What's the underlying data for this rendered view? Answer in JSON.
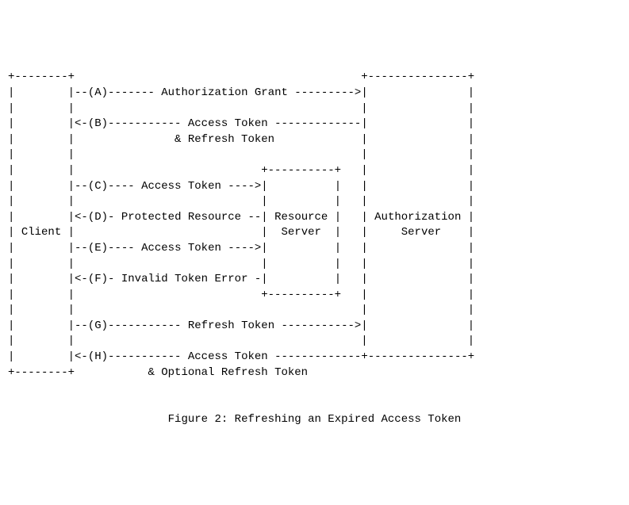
{
  "actors": {
    "client": "Client",
    "resource_server": "Resource",
    "resource_server_line2": "Server",
    "authorization_server": "Authorization",
    "authorization_server_line2": "Server"
  },
  "flows": {
    "A": "Authorization Grant",
    "B": "Access Token",
    "B_line2": "& Refresh Token",
    "C": "Access Token",
    "D": "Protected Resource",
    "E": "Access Token",
    "F": "Invalid Token Error",
    "G": "Refresh Token",
    "H": "Access Token",
    "H_line2": "& Optional Refresh Token"
  },
  "labels": {
    "A": "(A)",
    "B": "(B)",
    "C": "(C)",
    "D": "(D)",
    "E": "(E)",
    "F": "(F)",
    "G": "(G)",
    "H": "(H)"
  },
  "caption": "Figure 2: Refreshing an Expired Access Token"
}
